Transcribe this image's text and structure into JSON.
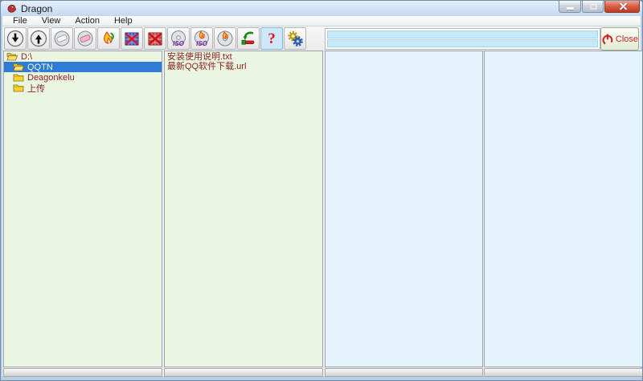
{
  "window": {
    "title": "Dragon",
    "icons": {
      "title": "dragon-icon",
      "minimize": "minimize-icon",
      "maximize": "maximize-icon",
      "close": "close-window-icon"
    }
  },
  "menu": {
    "items": [
      "File",
      "View",
      "Action",
      "Help"
    ]
  },
  "toolbar": {
    "buttons": [
      {
        "icon": "arrow-down-disc-icon"
      },
      {
        "icon": "arrow-up-disc-icon"
      },
      {
        "icon": "disc-wipe-icon"
      },
      {
        "icon": "disc-erase-icon"
      },
      {
        "icon": "flame-convert-icon"
      },
      {
        "icon": "grid-cross-blue-icon"
      },
      {
        "icon": "grid-cross-red-icon"
      },
      {
        "icon": "iso-disc-icon"
      },
      {
        "icon": "iso-burn-icon"
      },
      {
        "icon": "disc-burn-icon"
      },
      {
        "icon": "eject-disc-icon"
      },
      {
        "icon": "question-mark-icon"
      },
      {
        "icon": "gears-icon"
      }
    ],
    "iso_label": "ISO",
    "help_glyph": "?",
    "close_button": {
      "label": "Close",
      "icon": "power-icon"
    }
  },
  "panels": {
    "tree": {
      "items": [
        {
          "label": "D:\\",
          "icon": "folder-open-icon",
          "selected": false
        },
        {
          "label": "QQTN",
          "icon": "folder-open-icon",
          "selected": true
        },
        {
          "label": "Deagonkelu",
          "icon": "folder-closed-icon",
          "selected": false
        },
        {
          "label": "上传",
          "icon": "folder-closed-icon",
          "selected": false
        }
      ]
    },
    "file_list": {
      "items": [
        {
          "label": "安装使用说明.txt"
        },
        {
          "label": "最新QQ软件下载.url"
        }
      ]
    }
  },
  "colors": {
    "selection": "#2e7cd6",
    "tree_text": "#8b1e1e",
    "panel_green": "#eaf6e2",
    "panel_blue": "#e4f3fb",
    "progress_blue": "#c5e9f7",
    "close_red": "#cc2222",
    "titlebar_blue": "#c3d8ef"
  }
}
